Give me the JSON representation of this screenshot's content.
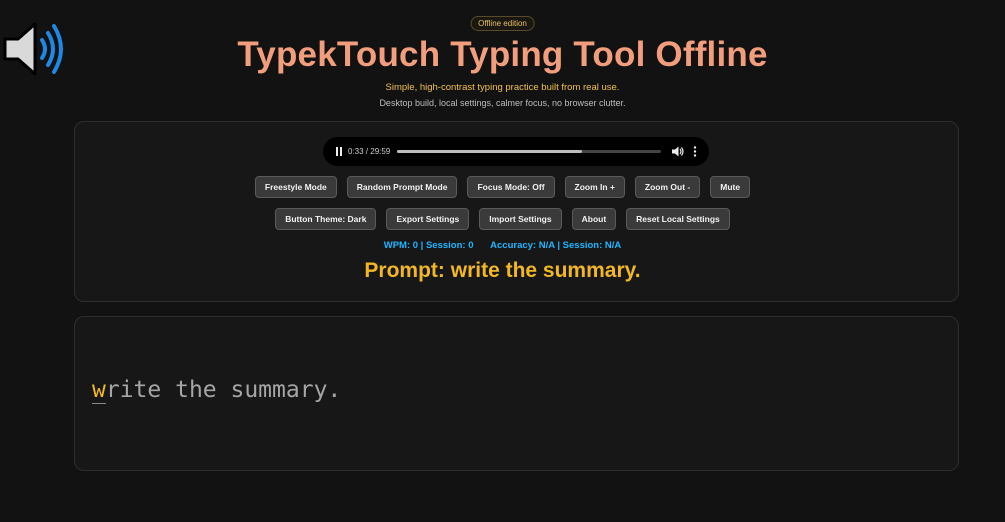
{
  "header": {
    "badge": "Offline edition",
    "title": "TypekTouch Typing Tool Offline",
    "subtitle": "Simple, high-contrast typing practice built from real use.",
    "tagline": "Desktop build, local settings, calmer focus, no browser clutter."
  },
  "speaker_icon": "speaker-volume-icon",
  "audio": {
    "time": "0:33 / 29:59",
    "progress_fraction": 0.7
  },
  "controls": {
    "row1": [
      "Freestyle Mode",
      "Random Prompt Mode",
      "Focus Mode: Off",
      "Zoom In +",
      "Zoom Out -",
      "Mute"
    ],
    "row2": [
      "Button Theme: Dark",
      "Export Settings",
      "Import Settings",
      "About",
      "Reset Local Settings"
    ]
  },
  "stats": {
    "wpm": "WPM: 0 | Session: 0",
    "accuracy": "Accuracy: N/A | Session: N/A"
  },
  "prompt": "Prompt: write the summary.",
  "typing": {
    "current_char": "w",
    "remaining": "rite the summary."
  },
  "colors": {
    "background": "#121212",
    "title": "#f29e7c",
    "subtitle": "#f2c14e",
    "stats": "#1fb6ff",
    "prompt": "#f2b824"
  }
}
